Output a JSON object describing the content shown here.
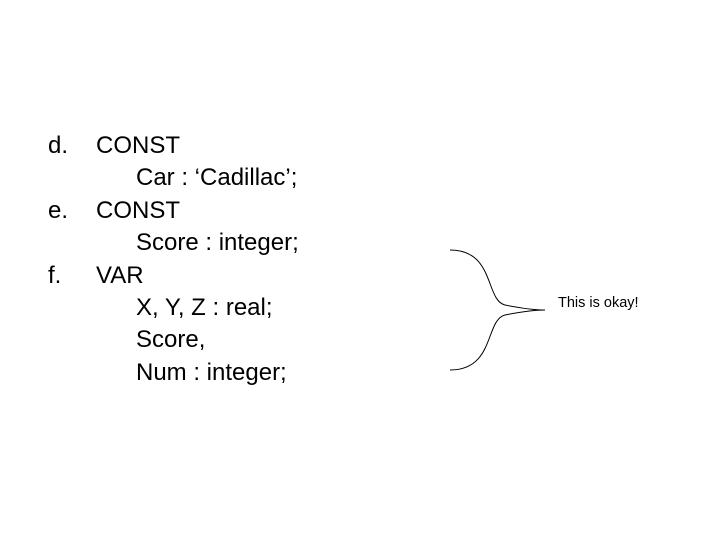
{
  "items": [
    {
      "marker": "d.",
      "head": "CONST",
      "lines": [
        "Car : ‘Cadillac’;"
      ]
    },
    {
      "marker": "e.",
      "head": "CONST",
      "lines": [
        "Score : integer;"
      ]
    },
    {
      "marker": "f.",
      "head": "VAR",
      "lines": [
        "X, Y, Z : real;",
        "Score,",
        "Num : integer;"
      ]
    }
  ],
  "annotation": "This is okay!"
}
